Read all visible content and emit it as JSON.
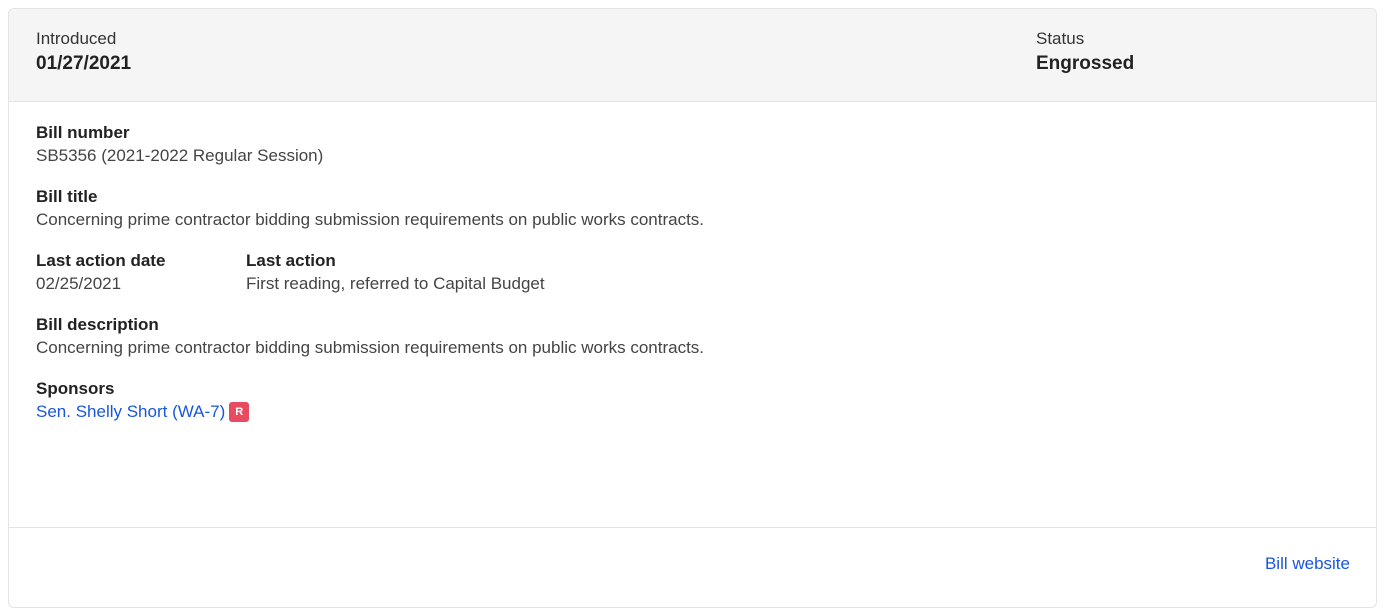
{
  "header": {
    "introduced_label": "Introduced",
    "introduced_value": "01/27/2021",
    "status_label": "Status",
    "status_value": "Engrossed"
  },
  "bill_number": {
    "label": "Bill number",
    "value": "SB5356 (2021-2022 Regular Session)"
  },
  "bill_title": {
    "label": "Bill title",
    "value": "Concerning prime contractor bidding submission requirements on public works contracts."
  },
  "last_action_date": {
    "label": "Last action date",
    "value": "02/25/2021"
  },
  "last_action": {
    "label": "Last action",
    "value": "First reading, referred to Capital Budget"
  },
  "bill_description": {
    "label": "Bill description",
    "value": "Concerning prime contractor bidding submission requirements on public works contracts."
  },
  "sponsors": {
    "label": "Sponsors",
    "items": [
      {
        "name": "Sen. Shelly Short (WA-7)",
        "party": "R",
        "party_color": "#e84a5f"
      }
    ]
  },
  "footer": {
    "website_link": "Bill website"
  },
  "colors": {
    "link": "#1a56db",
    "header_bg": "#f5f5f5"
  }
}
